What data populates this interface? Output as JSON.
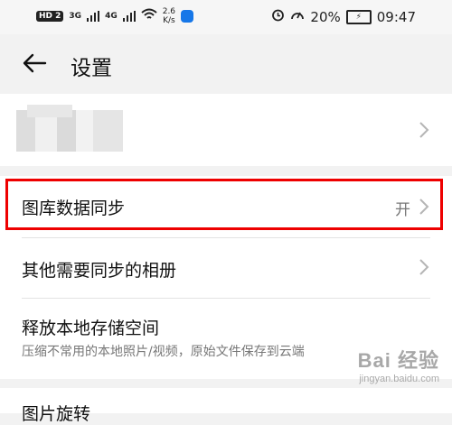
{
  "status_bar": {
    "hd": "HD 2",
    "sig1": "3G",
    "sig2": "4G",
    "speed_value": "2.6",
    "speed_unit": "K/s",
    "battery": "20%",
    "time": "09:47"
  },
  "header": {
    "title": "设置",
    "back_icon": "arrow-left-icon"
  },
  "account": {
    "chevron_icon": "chevron-right-icon"
  },
  "settings": [
    {
      "label": "图库数据同步",
      "value": "开",
      "sub": ""
    },
    {
      "label": "其他需要同步的相册",
      "value": "",
      "sub": ""
    },
    {
      "label": "释放本地存储空间",
      "value": "",
      "sub": "压缩不常用的本地照片/视频，原始文件保存到云端"
    }
  ],
  "bottom_item": {
    "label": "图片旋转"
  },
  "watermark": {
    "main": "Bai 经验",
    "sub": "jingyan.baidu.com"
  },
  "colors": {
    "highlight": "#ee0000",
    "background": "#f2f2f2"
  }
}
